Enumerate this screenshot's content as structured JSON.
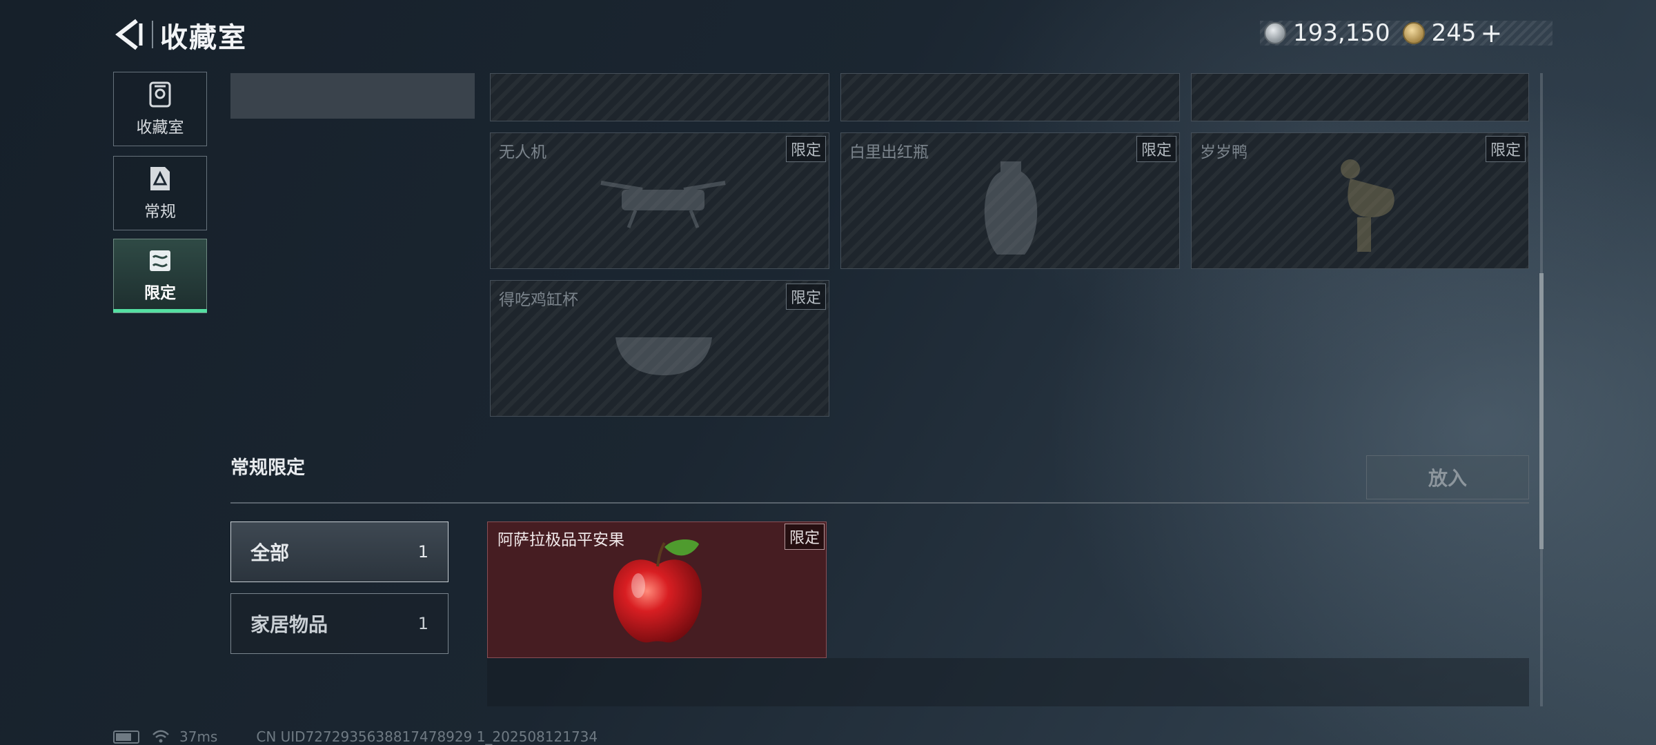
{
  "header": {
    "title": "收藏室",
    "currency1": "193,150",
    "currency2": "245",
    "add_symbol": "+"
  },
  "nav": [
    {
      "label": "收藏室",
      "icon": "collection-icon",
      "active": false
    },
    {
      "label": "常规",
      "icon": "regular-icon",
      "active": false
    },
    {
      "label": "限定",
      "icon": "limited-icon",
      "active": true
    }
  ],
  "limited_grid": [
    {
      "name": "无人机",
      "tag": "限定"
    },
    {
      "name": "白里出红瓶",
      "tag": "限定"
    },
    {
      "name": "岁岁鸭",
      "tag": "限定"
    },
    {
      "name": "得吃鸡缸杯",
      "tag": "限定"
    }
  ],
  "section": {
    "title": "常规限定",
    "place_button": "放入"
  },
  "filters": [
    {
      "label": "全部",
      "count": "1"
    },
    {
      "label": "家居物品",
      "count": "1"
    }
  ],
  "items": [
    {
      "name": "阿萨拉极品平安果",
      "tag": "限定"
    }
  ],
  "status_bar": {
    "ping": "37ms",
    "uid": "CN UID7272935638817478929 1_202508121734"
  },
  "colors": {
    "accent": "#54e0a2",
    "item_bg": "#461d22"
  }
}
